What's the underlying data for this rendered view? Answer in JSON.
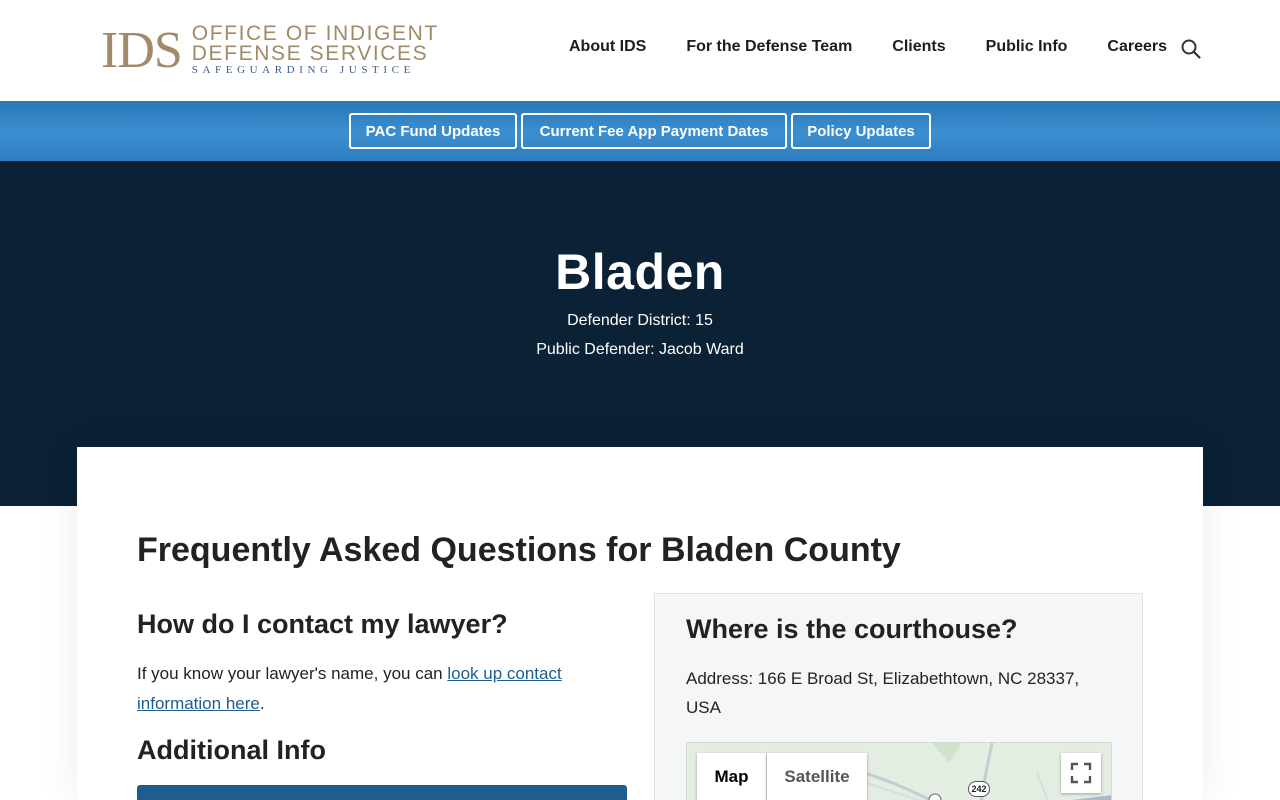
{
  "logo": {
    "abbr": "IDS",
    "line1": "OFFICE OF INDIGENT",
    "line2": "DEFENSE SERVICES",
    "tagline": "SAFEGUARDING JUSTICE"
  },
  "nav": {
    "items": [
      "About IDS",
      "For the Defense Team",
      "Clients",
      "Public Info",
      "Careers"
    ],
    "search_icon": "search-icon"
  },
  "quicklinks": [
    "PAC Fund Updates",
    "Current Fee App Payment Dates",
    "Policy Updates"
  ],
  "hero": {
    "title": "Bladen",
    "district": "Defender District: 15",
    "defender": "Public Defender: Jacob Ward"
  },
  "faq": {
    "title": "Frequently Asked Questions for Bladen County",
    "contact_title": "How do I contact my lawyer?",
    "contact_text_before": "If you know your lawyer's name, you can ",
    "contact_link": "look up contact information here",
    "contact_text_after": ".",
    "additional_title": "Additional Info"
  },
  "courthouse": {
    "title": "Where is the courthouse?",
    "address": "Address: 166 E Broad St, Elizabethtown, NC 28337, USA",
    "map_tabs": [
      "Map",
      "Satellite"
    ],
    "route_label": "242"
  },
  "colors": {
    "logo_gold": "#a08a68",
    "logo_blue": "#3e5f8a",
    "quickbar_blue": "#3b8fd0",
    "hero_navy": "#0a2136",
    "link_blue": "#1f5c8f"
  }
}
